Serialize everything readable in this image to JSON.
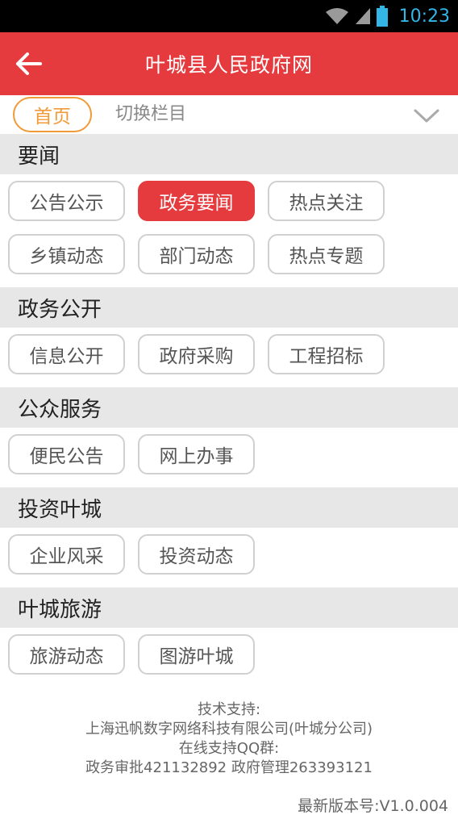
{
  "status_bar": {
    "time": "10:23",
    "icons": [
      "wifi-icon",
      "signal-icon",
      "battery-icon"
    ]
  },
  "app_bar": {
    "title": "叶城县人民政府网",
    "back_icon": "arrow-left-icon"
  },
  "tabs": {
    "home": "首页",
    "switch": "切换栏目",
    "expand_icon": "chevron-down-icon"
  },
  "sections": [
    {
      "title": "要闻",
      "items": [
        "公告公示",
        "政务要闻",
        "热点关注",
        "乡镇动态",
        "部门动态",
        "热点专题"
      ],
      "active": "政务要闻"
    },
    {
      "title": "政务公开",
      "items": [
        "信息公开",
        "政府采购",
        "工程招标"
      ]
    },
    {
      "title": "公众服务",
      "items": [
        "便民公告",
        "网上办事"
      ]
    },
    {
      "title": "投资叶城",
      "items": [
        "企业风采",
        "投资动态"
      ]
    },
    {
      "title": "叶城旅游",
      "items": [
        "旅游动态",
        "图游叶城"
      ]
    }
  ],
  "footer": {
    "line1": "技术支持:",
    "line2": "上海迅帆数字网络科技有限公司(叶城分公司)",
    "line3": "在线支持QQ群:",
    "line4": "政务审批421132892 政府管理263393121",
    "version": "最新版本号:V1.0.004"
  },
  "colors": {
    "primary": "#e53b3e",
    "tab_accent": "#f19a38",
    "status_time": "#33b5e5"
  }
}
